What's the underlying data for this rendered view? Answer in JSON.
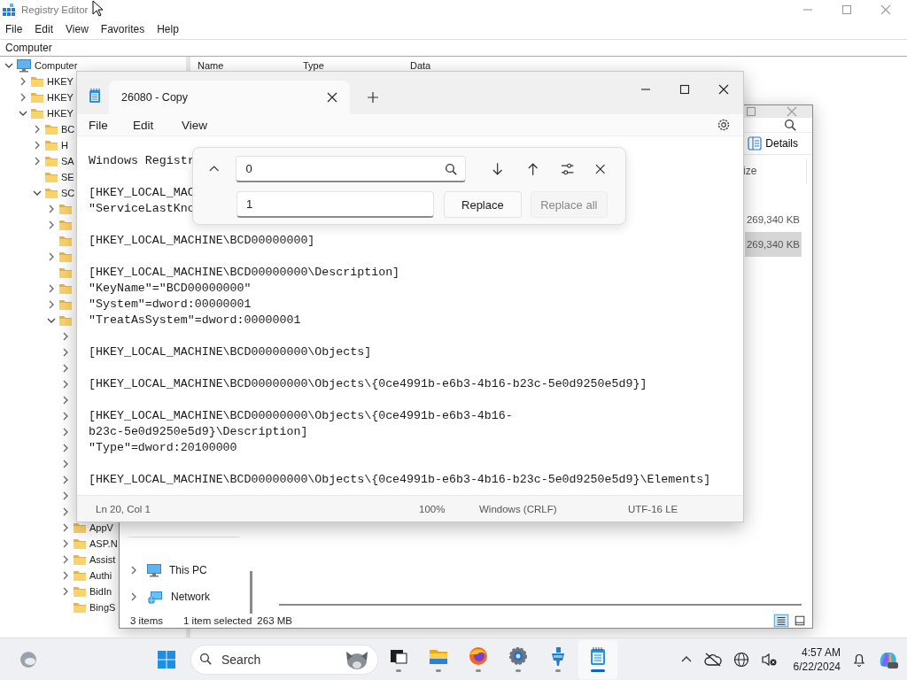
{
  "registry": {
    "title": "Registry Editor",
    "menu": [
      "File",
      "Edit",
      "View",
      "Favorites",
      "Help"
    ],
    "address": "Computer",
    "columns": [
      "Name",
      "Type",
      "Data"
    ],
    "tree": [
      {
        "label": "Computer",
        "kind": "computer",
        "expanded": true,
        "children": [
          {
            "label": "HKEY",
            "kind": "folder",
            "expanded": false
          },
          {
            "label": "HKEY",
            "kind": "folder",
            "expanded": false
          },
          {
            "label": "HKEY",
            "kind": "folder",
            "expanded": true,
            "children": [
              {
                "label": "BC",
                "kind": "folder",
                "expanded": false
              },
              {
                "label": "H",
                "kind": "folder",
                "expanded": false
              },
              {
                "label": "SA",
                "kind": "folder",
                "expanded": false
              },
              {
                "label": "SE",
                "kind": "leaf"
              },
              {
                "label": "SC",
                "kind": "folder",
                "expanded": true,
                "children": [
                  {
                    "kind": "folder",
                    "expanded": false
                  },
                  {
                    "kind": "folder",
                    "expanded": false
                  },
                  {
                    "kind": "leaf"
                  },
                  {
                    "kind": "folder",
                    "expanded": false
                  },
                  {
                    "kind": "leaf"
                  },
                  {
                    "kind": "folder",
                    "expanded": false
                  },
                  {
                    "kind": "folder",
                    "expanded": false
                  },
                  {
                    "kind": "folder",
                    "expanded": true,
                    "children": [
                      {
                        "kind": "folder",
                        "expanded": false
                      },
                      {
                        "kind": "folder",
                        "expanded": false
                      },
                      {
                        "kind": "folder",
                        "expanded": false
                      },
                      {
                        "kind": "folder",
                        "expanded": false
                      },
                      {
                        "kind": "folder",
                        "expanded": false
                      },
                      {
                        "kind": "folder",
                        "expanded": false
                      },
                      {
                        "kind": "folder",
                        "expanded": false
                      },
                      {
                        "kind": "folder",
                        "expanded": false
                      },
                      {
                        "kind": "folder",
                        "expanded": false
                      },
                      {
                        "kind": "folder",
                        "expanded": false
                      },
                      {
                        "kind": "folder",
                        "expanded": false
                      },
                      {
                        "kind": "folder",
                        "expanded": false
                      },
                      {
                        "label": "AppV",
                        "kind": "folder",
                        "expanded": false
                      },
                      {
                        "label": "ASP.N",
                        "kind": "folder",
                        "expanded": false
                      },
                      {
                        "label": "Assist",
                        "kind": "folder",
                        "expanded": false
                      },
                      {
                        "label": "Authi",
                        "kind": "folder",
                        "expanded": false
                      },
                      {
                        "label": "BidIn",
                        "kind": "folder",
                        "expanded": false
                      },
                      {
                        "label": "BingS",
                        "kind": "leaf"
                      }
                    ]
                  }
                ]
              }
            ]
          }
        ]
      }
    ]
  },
  "explorer": {
    "details_button": "Details",
    "column": "ize",
    "rows": [
      {
        "size": "269,340 KB",
        "selected": false
      },
      {
        "size": "269,340 KB",
        "selected": true
      }
    ],
    "nav": [
      {
        "label": "This PC",
        "kind": "pc"
      },
      {
        "label": "Network",
        "kind": "network"
      }
    ],
    "status": {
      "count": "3 items",
      "selection": "1 item selected",
      "size": "263 MB"
    },
    "views": [
      {
        "kind": "details",
        "selected": true
      },
      {
        "kind": "tiles",
        "selected": false
      }
    ]
  },
  "notepad": {
    "tab": "26080 - Copy",
    "menu": [
      "File",
      "Edit",
      "View"
    ],
    "blocks": [
      [
        "Windows Registr"
      ],
      [
        "[HKEY_LOCAL_MAC",
        "\"ServiceLastKno"
      ],
      [
        "[HKEY_LOCAL_MACHINE\\BCD00000000]"
      ],
      [
        "[HKEY_LOCAL_MACHINE\\BCD00000000\\Description]",
        "\"KeyName\"=\"BCD00000000\"",
        "\"System\"=dword:00000001",
        "\"TreatAsSystem\"=dword:00000001"
      ],
      [
        "[HKEY_LOCAL_MACHINE\\BCD00000000\\Objects]"
      ],
      [
        "[HKEY_LOCAL_MACHINE\\BCD00000000\\Objects\\{0ce4991b-e6b3-4b16-b23c-5e0d9250e5d9}]"
      ],
      [
        "[HKEY_LOCAL_MACHINE\\BCD00000000\\Objects\\{0ce4991b-e6b3-4b16-",
        "b23c-5e0d9250e5d9}\\Description]",
        "\"Type\"=dword:20100000"
      ],
      [
        "[HKEY_LOCAL_MACHINE\\BCD00000000\\Objects\\{0ce4991b-e6b3-4b16-b23c-5e0d9250e5d9}\\Elements]"
      ]
    ],
    "find": {
      "value": "0",
      "replace": "1",
      "buttons": [
        {
          "label": "Replace",
          "disabled": false
        },
        {
          "label": "Replace all",
          "disabled": true
        }
      ]
    },
    "status": [
      "Ln 20, Col 1",
      "100%",
      "Windows (CRLF)",
      "UTF-16 LE"
    ]
  },
  "taskbar": {
    "search_placeholder": "Search",
    "apps": [
      {
        "kind": "taskview",
        "active": false
      },
      {
        "kind": "explorer",
        "active": false
      },
      {
        "kind": "browser",
        "active": false
      },
      {
        "kind": "settings",
        "active": false
      },
      {
        "kind": "figure",
        "active": false
      },
      {
        "kind": "notepad",
        "active": true
      }
    ],
    "time": "4:57 AM",
    "date": "6/22/2024"
  }
}
